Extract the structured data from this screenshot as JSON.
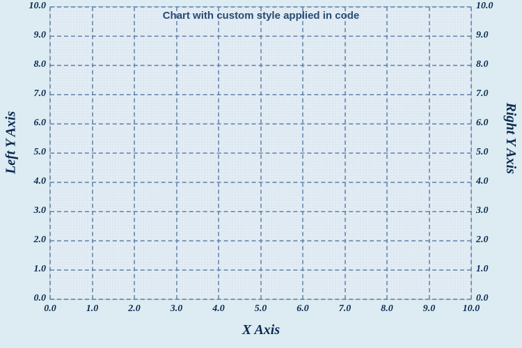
{
  "chart_data": {
    "type": "line",
    "title": "Chart with custom style applied in code",
    "xlabel": "X Axis",
    "ylabel_left": "Left Y Axis",
    "ylabel_right": "Right Y Axis",
    "xlim": [
      0,
      10
    ],
    "ylim": [
      0,
      10
    ],
    "x_ticks": [
      "0.0",
      "1.0",
      "2.0",
      "3.0",
      "4.0",
      "5.0",
      "6.0",
      "7.0",
      "8.0",
      "9.0",
      "10.0"
    ],
    "y_ticks_left": [
      "0.0",
      "1.0",
      "2.0",
      "3.0",
      "4.0",
      "5.0",
      "6.0",
      "7.0",
      "8.0",
      "9.0",
      "10.0"
    ],
    "y_ticks_right": [
      "0.0",
      "1.0",
      "2.0",
      "3.0",
      "4.0",
      "5.0",
      "6.0",
      "7.0",
      "8.0",
      "9.0",
      "10.0"
    ],
    "series": [],
    "grid": true
  }
}
